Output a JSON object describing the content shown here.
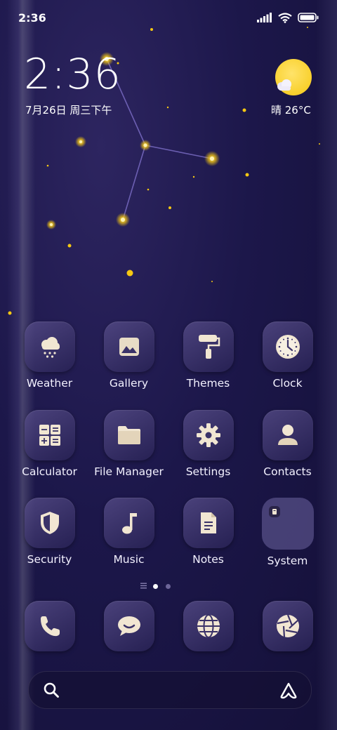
{
  "status_bar": {
    "time": "2:36",
    "icons": [
      "signal-icon",
      "wifi-icon",
      "battery-icon"
    ]
  },
  "clock_widget": {
    "time": "2:36",
    "date": "7月26日 周三下午"
  },
  "weather_widget": {
    "icon": "sun-cloud-icon",
    "condition_temp": "晴 26°C"
  },
  "apps": [
    {
      "label": "Weather",
      "icon": "weather-snow-cloud-icon"
    },
    {
      "label": "Gallery",
      "icon": "gallery-image-icon"
    },
    {
      "label": "Themes",
      "icon": "paint-roller-icon"
    },
    {
      "label": "Clock",
      "icon": "clock-icon"
    },
    {
      "label": "Calculator",
      "icon": "calculator-icon"
    },
    {
      "label": "File Manager",
      "icon": "folder-icon"
    },
    {
      "label": "Settings",
      "icon": "gear-icon"
    },
    {
      "label": "Contacts",
      "icon": "person-icon"
    },
    {
      "label": "Security",
      "icon": "shield-icon"
    },
    {
      "label": "Music",
      "icon": "music-note-icon"
    },
    {
      "label": "Notes",
      "icon": "note-document-icon"
    },
    {
      "label": "System",
      "icon": "folder-group-icon"
    }
  ],
  "pager": {
    "pages": 2,
    "current": 1
  },
  "dock": [
    {
      "icon": "phone-icon"
    },
    {
      "icon": "message-bubble-icon"
    },
    {
      "icon": "browser-globe-icon"
    },
    {
      "icon": "camera-aperture-icon"
    }
  ],
  "search": {
    "icon": "search-icon",
    "assistant_icon": "assistant-icon"
  },
  "colors": {
    "background": "#1c174a",
    "star": "#f6c812",
    "icon_glyph": "#f1e6d2"
  }
}
